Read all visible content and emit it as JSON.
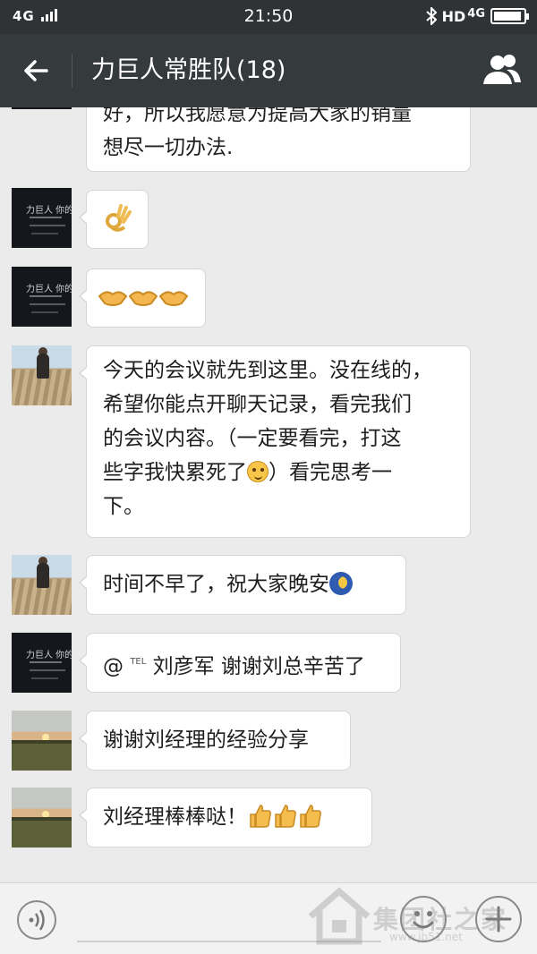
{
  "status_bar": {
    "network": "4G",
    "time": "21:50",
    "bt_icon": "bluetooth-icon",
    "hd_label": "HD",
    "net_right": "4G",
    "battery_level": 0.95
  },
  "header": {
    "title": "力巨人常胜队(18)",
    "back_icon": "arrow-left-icon",
    "members_icon": "group-members-icon"
  },
  "avatars": {
    "dark_text": "力巨人 你的荣"
  },
  "messages": [
    {
      "sender": "dark",
      "lines": [
        "好，所以我愿意为提高大家的销量",
        "想尽一切办法."
      ]
    },
    {
      "sender": "dark",
      "emoji": "ok-hand-emoji"
    },
    {
      "sender": "dark",
      "emoji": "handshake-emoji"
    },
    {
      "sender": "roof",
      "lines": [
        "今天的会议就先到这里。没在线的，",
        "希望你能点开聊天记录，看完我们",
        "的会议内容。（一定要看完，打这",
        "些字我快累死了",
        "）看完思考一",
        "下。"
      ]
    },
    {
      "sender": "roof",
      "text": "时间不早了，祝大家晚安"
    },
    {
      "sender": "dark",
      "mention": "@",
      "tag": "TEL",
      "text": "刘彦军 谢谢刘总辛苦了"
    },
    {
      "sender": "sunset",
      "text": "谢谢刘经理的经验分享"
    },
    {
      "sender": "sunset",
      "text": "刘经理棒棒哒！"
    }
  ],
  "input_bar": {
    "voice_icon": "voice-icon",
    "emoji_icon": "smiley-icon",
    "plus_icon": "plus-icon"
  },
  "watermark": {
    "text": "集团社之家",
    "url": "www.jb51.net"
  },
  "colors": {
    "header_bg": "#353a3d",
    "status_bg": "#2f3335",
    "chat_bg": "#ebebeb",
    "bubble_bg": "#ffffff"
  }
}
